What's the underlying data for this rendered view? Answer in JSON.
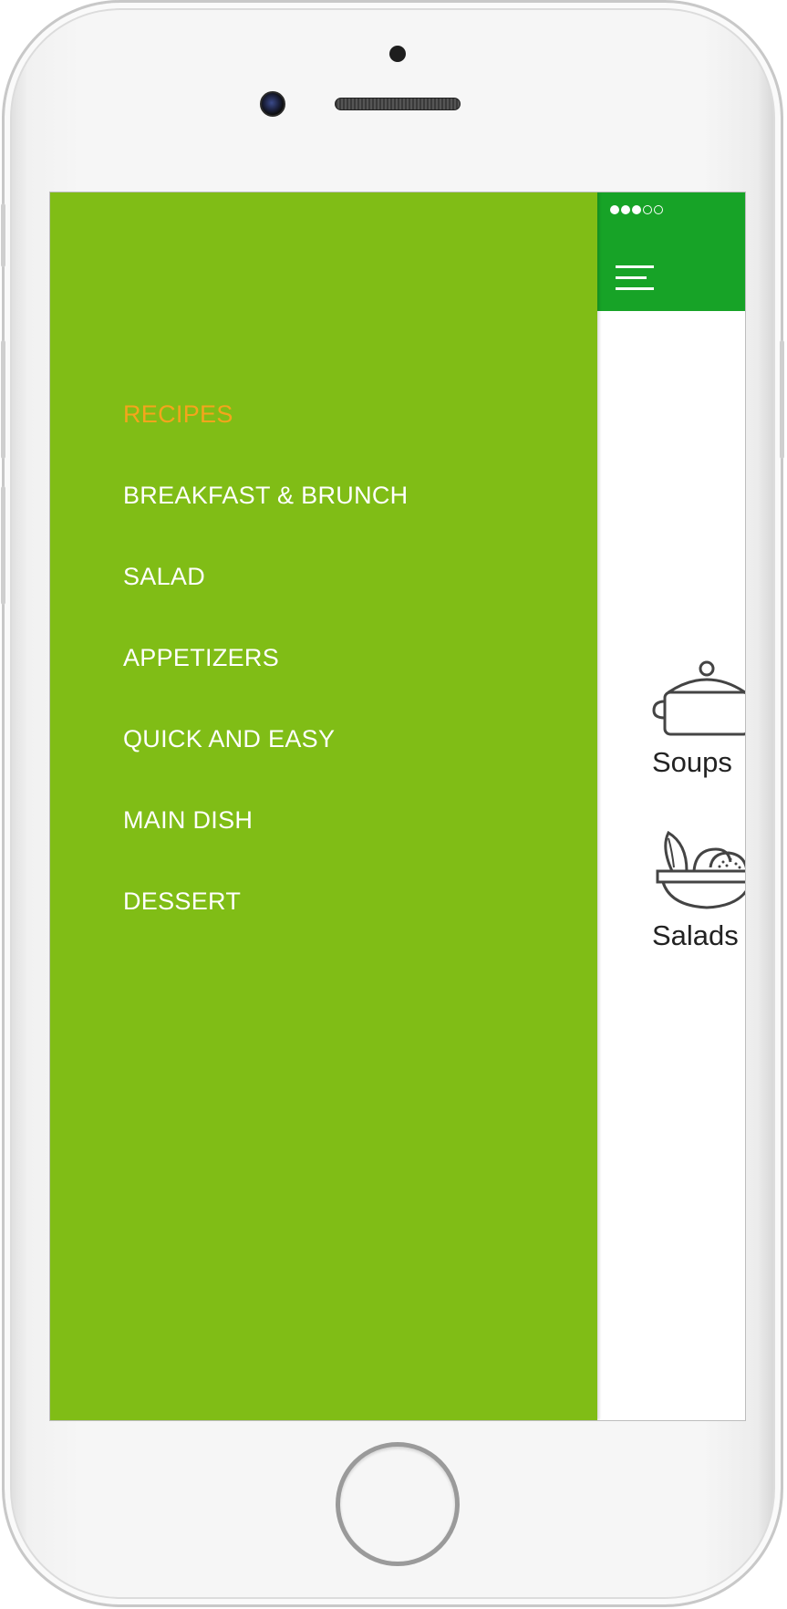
{
  "drawer": {
    "background": "#80bd16",
    "active_color": "#f4a51c",
    "items": [
      {
        "label": "RECIPES",
        "active": true
      },
      {
        "label": "BREAKFAST & BRUNCH",
        "active": false
      },
      {
        "label": "SALAD",
        "active": false
      },
      {
        "label": "APPETIZERS",
        "active": false
      },
      {
        "label": "QUICK AND EASY",
        "active": false
      },
      {
        "label": "MAIN DISH",
        "active": false
      },
      {
        "label": "DESSERT",
        "active": false
      }
    ]
  },
  "topbar": {
    "background": "#17a327",
    "signal_icon": "signal-strength-icon",
    "signal_bars_filled": 3,
    "signal_bars_total": 5,
    "menu_icon": "hamburger-menu-icon"
  },
  "categories": [
    {
      "label": "Soups",
      "icon": "pot-icon"
    },
    {
      "label": "Salads",
      "icon": "salad-bowl-icon"
    }
  ]
}
